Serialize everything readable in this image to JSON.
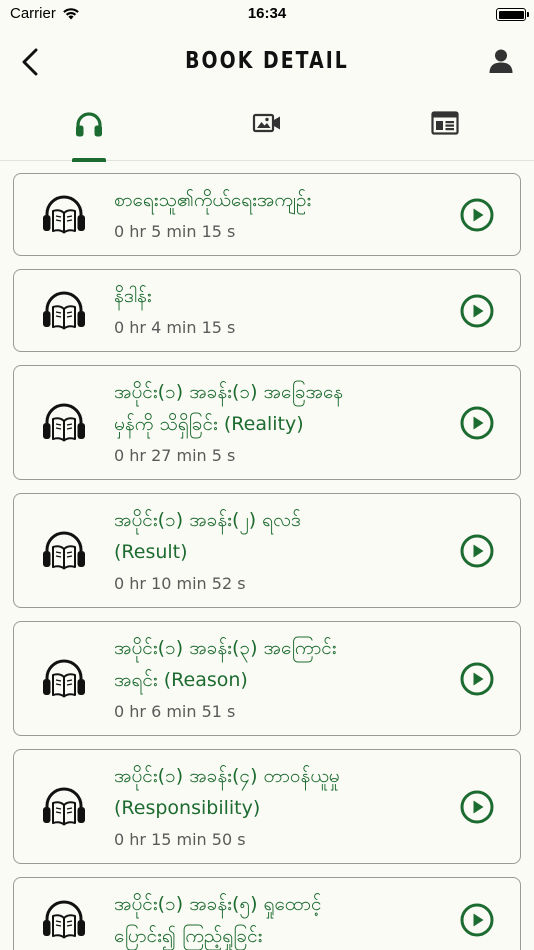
{
  "status_bar": {
    "carrier": "Carrier",
    "time": "16:34"
  },
  "nav": {
    "title": "BOOK DETAIL"
  },
  "accent_color": "#1c6b30",
  "tabs": [
    {
      "icon": "headphones-icon",
      "active": true
    },
    {
      "icon": "video-icon",
      "active": false
    },
    {
      "icon": "newspaper-icon",
      "active": false
    }
  ],
  "tracks": [
    {
      "title_lines": [
        "စာရေးသူ၏ကိုယ်ရေးအကျဉ်း"
      ],
      "duration": "0 hr 5 min 15 s"
    },
    {
      "title_lines": [
        "နိဒါန်း"
      ],
      "duration": "0 hr 4 min 15 s"
    },
    {
      "title_lines": [
        "အပိုင်း(၁) အခန်း(၁) အခြေအနေ",
        "မှန်ကို သိရှိခြင်း (Reality)"
      ],
      "duration": "0 hr 27 min 5 s"
    },
    {
      "title_lines": [
        "အပိုင်း(၁) အခန်း(၂) ရလဒ်",
        "(Result)"
      ],
      "duration": "0 hr 10 min 52 s"
    },
    {
      "title_lines": [
        "အပိုင်း(၁) အခန်း(၃) အကြောင်း",
        "အရင်း (Reason)"
      ],
      "duration": "0 hr 6 min 51 s"
    },
    {
      "title_lines": [
        "အပိုင်း(၁) အခန်း(၄) တာဝန်ယူမှု",
        "(Responsibility)"
      ],
      "duration": "0 hr 15 min 50 s"
    },
    {
      "title_lines": [
        "အပိုင်း(၁) အခန်း(၅) ရှုထောင့်",
        "ပြောင်း၍ ကြည့်ရှုခြင်း"
      ],
      "duration": ""
    }
  ]
}
